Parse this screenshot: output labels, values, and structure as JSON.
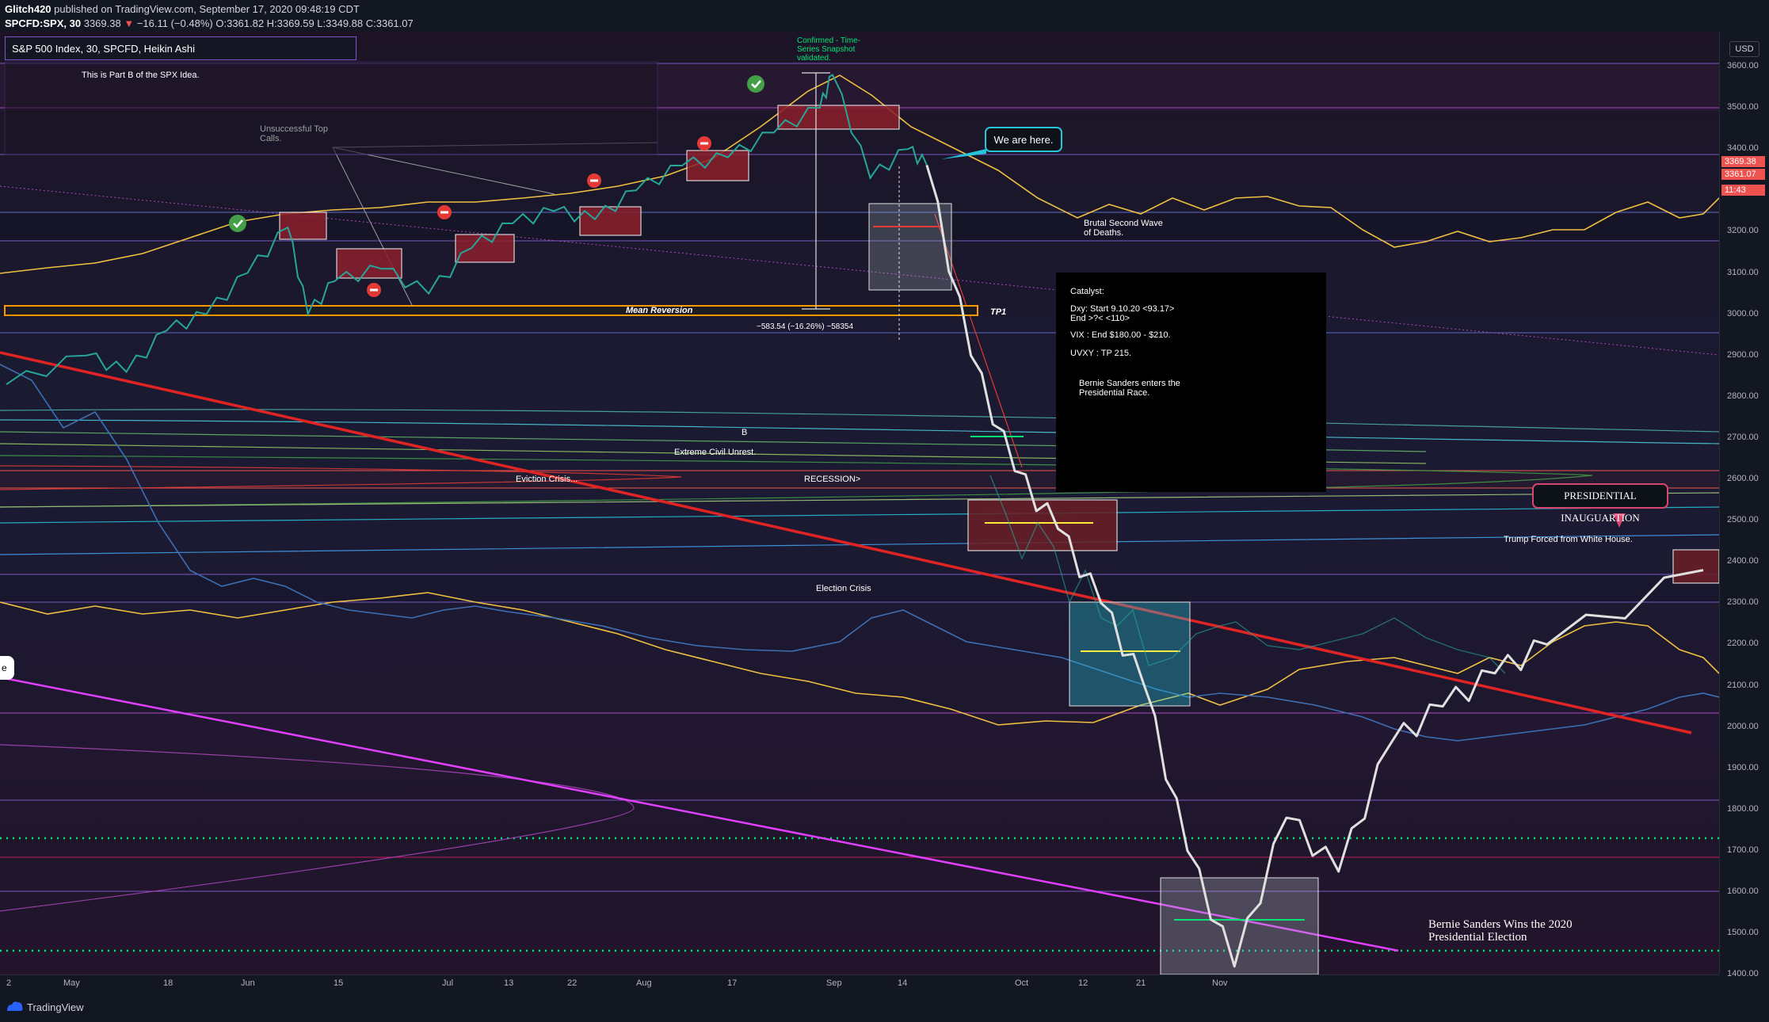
{
  "header": {
    "author": "Glitch420",
    "published_text": "published on TradingView.com, September 17, 2020 09:48:19 CDT",
    "symbol": "SPCFD:SPX, 30",
    "price": "3369.38",
    "change_arrow": "▼",
    "change": "−16.11 (−0.48%)",
    "ohlc": "O:3361.82 H:3369.59 L:3349.88 C:3361.07"
  },
  "legend": {
    "title": "S&P 500 Index, 30, SPCFD, Heikin Ashi"
  },
  "price_axis": {
    "currency": "USD",
    "labels": [
      "3600.00",
      "3500.00",
      "3400.00",
      "3",
      "3200.00",
      "3100.00",
      "3000.00",
      "2900.00",
      "2800.00",
      "2700.00",
      "2600.00",
      "2500.00",
      "2400.00",
      "2300.00",
      "2200.00",
      "2100.00",
      "2000.00",
      "1900.00",
      "1800.00",
      "1700.00",
      "1600.00",
      "1500.00",
      "1400.00"
    ],
    "tags": [
      {
        "text": "3369.38",
        "color": "#ef5350"
      },
      {
        "text": "3361.07",
        "color": "#ef5350"
      },
      {
        "text": "11:43",
        "color": "#ef5350"
      }
    ]
  },
  "time_axis": {
    "labels": [
      "2",
      "May",
      "18",
      "Jun",
      "15",
      "Jul",
      "13",
      "22",
      "Aug",
      "17",
      "Sep",
      "14",
      "Oct",
      "12",
      "21",
      "Nov"
    ]
  },
  "annotations": {
    "part_b": "This is Part B of the SPX Idea.",
    "unsuccessful": [
      "Unsuccessful Top",
      "Calls."
    ],
    "confirmed": [
      "Confirmed - Time-",
      "Series Snapshot",
      "validated."
    ],
    "we_are_here": "We are here.",
    "brutal": [
      "Brutal Second Wave",
      "of Deaths."
    ],
    "mean_reversion": "Mean Reversion",
    "tp1": "TP1",
    "measure": "−583.54 (−16.26%) −58354",
    "catalyst": {
      "title": "Catalyst:",
      "dxy": [
        "Dxy: Start 9.10.20 <93.17>",
        "End >?< <110>"
      ],
      "vix": "VIX : End $180.00 - $210.",
      "uvxy": "UVXY : TP 215.",
      "bernie": [
        "Bernie Sanders enters the",
        "Presidential Race."
      ]
    },
    "b_label": "B",
    "civil_unrest": "Extreme Civil Unrest.",
    "eviction": "Eviction Crisis...",
    "recession": "RECESSION>",
    "election_crisis": "Election Crisis",
    "inauguration": "PRESIDENTIAL INAUGUARTION",
    "trump": "Trump Forced from White House.",
    "bernie_wins": [
      "Bernie Sanders Wins the 2020",
      "Presidential Election"
    ],
    "edge_tab": "e"
  },
  "footer": {
    "brand": "TradingView"
  },
  "colors": {
    "background": "#131722",
    "candle_up": "#26a69a",
    "candle_down": "#ef5350",
    "trendline": "#e02424",
    "gold_line": "#f0c040",
    "blue_line": "#3d6fb4",
    "magenta_line": "#e040fb",
    "projection": "#e0e0e0",
    "green_dotted": "#00e676"
  },
  "chart_data": {
    "type": "line",
    "title": "S&P 500 Index, 30, SPCFD, Heikin Ashi",
    "price_range": [
      1380,
      3630
    ],
    "series": [
      {
        "name": "S&P 500 Index",
        "x": [
          "2020-04-28",
          "2020-05-05",
          "2020-05-12",
          "2020-05-19",
          "2020-05-26",
          "2020-06-02",
          "2020-06-08",
          "2020-06-11",
          "2020-06-15",
          "2020-06-22",
          "2020-06-29",
          "2020-07-06",
          "2020-07-13",
          "2020-07-20",
          "2020-07-27",
          "2020-08-03",
          "2020-08-10",
          "2020-08-17",
          "2020-08-24",
          "2020-08-31",
          "2020-09-02",
          "2020-09-08",
          "2020-09-14",
          "2020-09-17"
        ],
        "values": [
          2830,
          2900,
          2860,
          2960,
          3000,
          3100,
          3210,
          3000,
          3080,
          3110,
          3050,
          3160,
          3220,
          3250,
          3230,
          3300,
          3360,
          3380,
          3440,
          3500,
          3580,
          3330,
          3400,
          3361
        ]
      },
      {
        "name": "Projection",
        "x": [
          "2020-09-17",
          "2020-09-24",
          "2020-10-01",
          "2020-10-08",
          "2020-10-15",
          "2020-10-22",
          "2020-10-29",
          "2020-11-05",
          "2020-11-12",
          "2020-11-19",
          "2020-11-26",
          "2020-12-03",
          "2020-12-10",
          "2020-12-17",
          "2021-01-07"
        ],
        "values": [
          3361,
          2900,
          2620,
          2480,
          2300,
          2100,
          1700,
          1420,
          1780,
          1650,
          1960,
          2050,
          2130,
          2200,
          2380
        ]
      }
    ],
    "levels": [
      3600,
      3500,
      3400,
      3240,
      3170,
      3000,
      2920,
      2700,
      2300,
      2240,
      2030,
      1810,
      1720,
      1670,
      1590,
      1440
    ],
    "annotations": [
      "Mean Reversion",
      "TP1",
      "We are here.",
      "Brutal Second Wave of Deaths.",
      "Election Crisis",
      "Eviction Crisis...",
      "RECESSION>",
      "Extreme Civil Unrest.",
      "PRESIDENTIAL INAUGUARTION",
      "Trump Forced from White House.",
      "Bernie Sanders Wins the 2020 Presidential Election"
    ]
  }
}
